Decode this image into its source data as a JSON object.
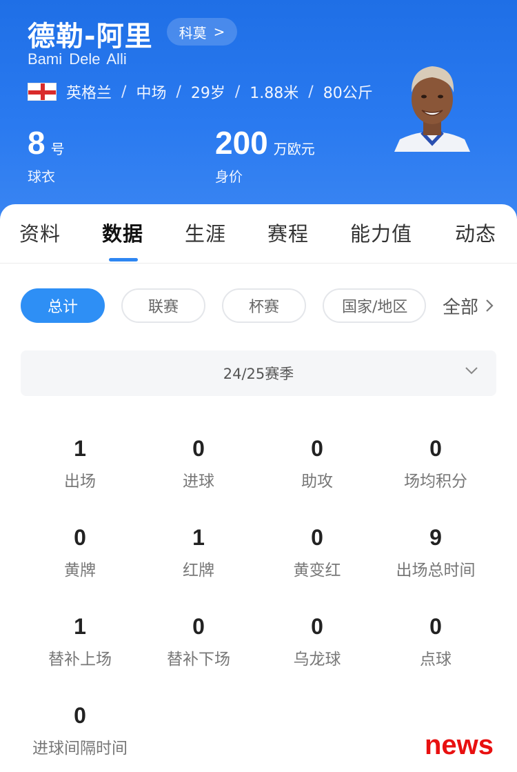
{
  "player": {
    "name": "德勒-阿里",
    "team": "科莫",
    "team_chevron": ">",
    "en_name": "Bami Dele Alli",
    "nationality": "英格兰",
    "position": "中场",
    "age": "29岁",
    "height": "1.88米",
    "weight": "80公斤",
    "separator": "/"
  },
  "stats_top": {
    "jersey_number": "8",
    "jersey_unit": "号",
    "jersey_label": "球衣",
    "value_number": "200",
    "value_unit": "万欧元",
    "value_label": "身价"
  },
  "tabs": [
    "资料",
    "数据",
    "生涯",
    "赛程",
    "能力值",
    "动态"
  ],
  "active_tab": "数据",
  "filters": {
    "chips": [
      "总计",
      "联赛",
      "杯赛",
      "国家/地区"
    ],
    "active_chip": "总计",
    "all_label": "全部"
  },
  "season": {
    "value": "24/25赛季"
  },
  "stats": [
    {
      "value": "1",
      "label": "出场"
    },
    {
      "value": "0",
      "label": "进球"
    },
    {
      "value": "0",
      "label": "助攻"
    },
    {
      "value": "0",
      "label": "场均积分"
    },
    {
      "value": "0",
      "label": "黄牌"
    },
    {
      "value": "1",
      "label": "红牌"
    },
    {
      "value": "0",
      "label": "黄变红"
    },
    {
      "value": "9",
      "label": "出场总时间"
    },
    {
      "value": "1",
      "label": "替补上场"
    },
    {
      "value": "0",
      "label": "替补下场"
    },
    {
      "value": "0",
      "label": "乌龙球"
    },
    {
      "value": "0",
      "label": "点球"
    },
    {
      "value": "0",
      "label": "进球间隔时间"
    }
  ],
  "watermark": "news",
  "colors": {
    "header_blue": "#2a7af0",
    "accent_blue": "#2e8ff5",
    "watermark_red": "#e81010"
  }
}
